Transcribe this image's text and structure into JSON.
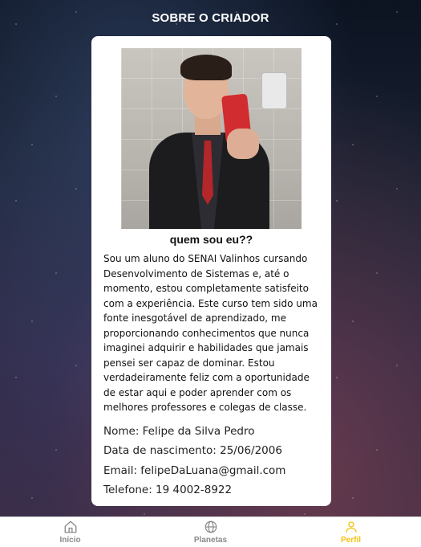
{
  "header": {
    "title": "SOBRE O CRIADOR"
  },
  "profile": {
    "heading": "quem sou eu??",
    "bio": "Sou um aluno do SENAI Valinhos cursando Desenvolvimento de Sistemas e, até o momento, estou completamente satisfeito com a experiência. Este curso tem sido uma fonte inesgotável de aprendizado, me proporcionando conhecimentos que nunca imaginei adquirir e habilidades que jamais pensei ser capaz de dominar. Estou verdadeiramente feliz com a oportunidade de estar aqui e poder aprender com os melhores professores e colegas de classe.",
    "name": "Nome: Felipe da Silva Pedro",
    "birthdate": "Data de nascimento: 25/06/2006",
    "email": "Email: felipeDaLuana@gmail.com",
    "phone": "Telefone: 19 4002-8922"
  },
  "tabs": [
    {
      "label": "Início",
      "icon": "home-icon",
      "active": false
    },
    {
      "label": "Planetas",
      "icon": "globe-icon",
      "active": false
    },
    {
      "label": "Perfil",
      "icon": "user-icon",
      "active": true
    }
  ],
  "colors": {
    "active_tab": "#f3c20f",
    "inactive_tab": "#8a8a8a"
  }
}
